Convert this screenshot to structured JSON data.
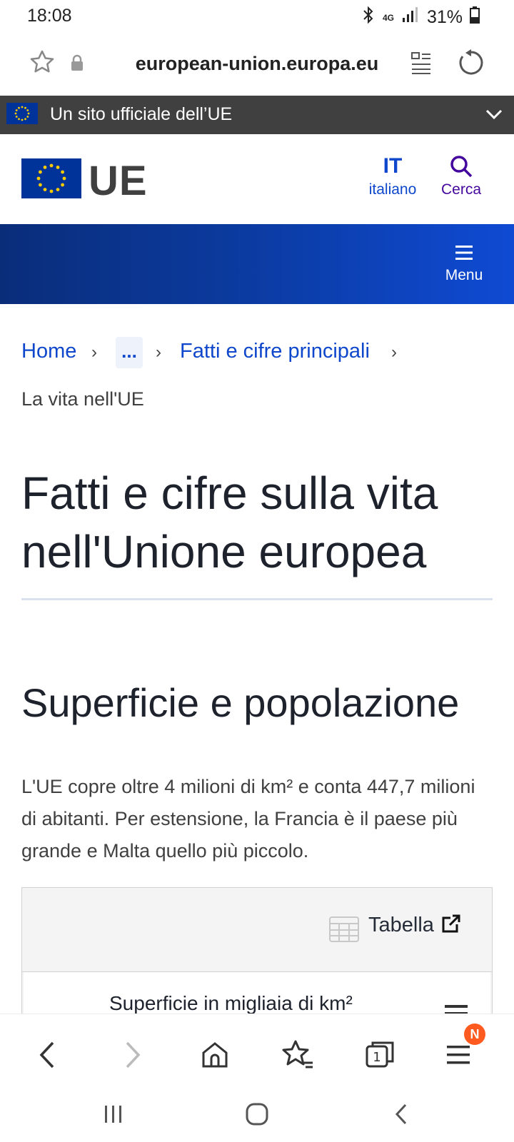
{
  "status_bar": {
    "time": "18:08",
    "network": "4G",
    "battery": "31%"
  },
  "browser": {
    "url": "european-union.europa.eu"
  },
  "official_banner": {
    "text": "Un sito ufficiale dell’UE"
  },
  "header": {
    "logo_text": "UE",
    "language_code": "IT",
    "language_label": "italiano",
    "search_label": "Cerca"
  },
  "menu": {
    "label": "Menu"
  },
  "breadcrumb": {
    "home": "Home",
    "ellipsis": "...",
    "facts": "Fatti e cifre principali",
    "current": "La vita nell'UE"
  },
  "main": {
    "title": "Fatti e cifre sulla vita nell'Unione europea",
    "section_title": "Superficie e popolazione",
    "intro": "L'UE copre oltre 4 milioni di km² e conta 447,7 milioni di abitanti. Per estensione, la Francia è il paese più grande e Malta quello più piccolo.",
    "table_link": "Tabella",
    "table_caption": "Superficie in migliaia di km²"
  },
  "bottom_nav": {
    "tabs_count": "1",
    "badge": "N"
  },
  "colors": {
    "accent": "#0e47cb",
    "banner": "#404040",
    "search": "#44079d",
    "badge": "#ff5a1f"
  }
}
